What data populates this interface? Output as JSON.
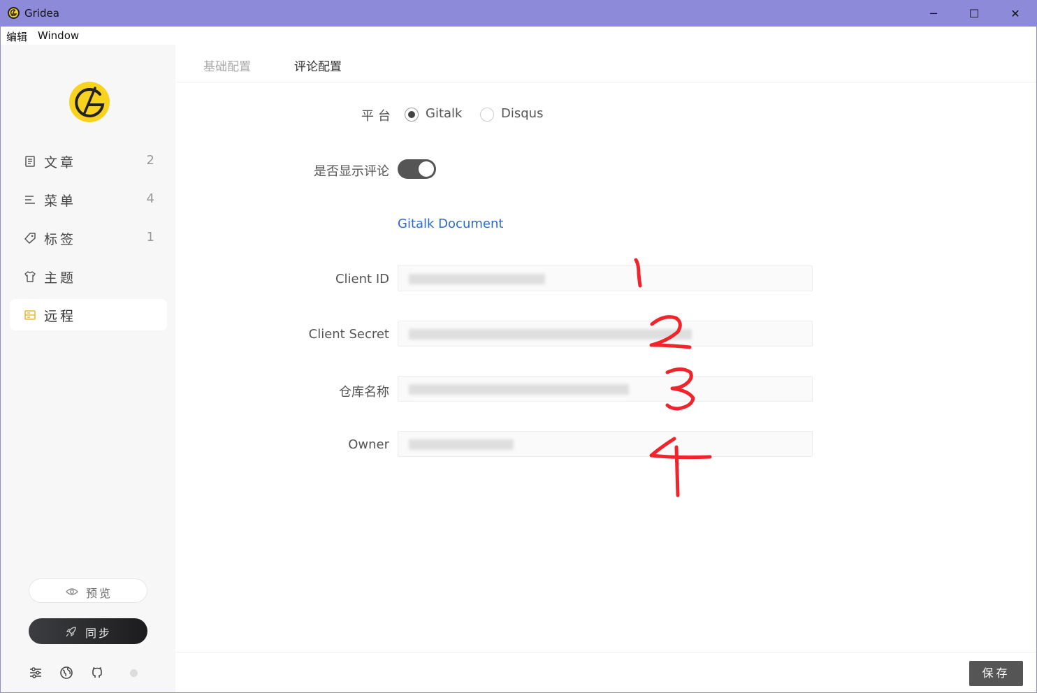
{
  "window": {
    "title": "Gridea",
    "controls": {
      "minimize": "─",
      "maximize": "☐",
      "close": "✕"
    }
  },
  "menubar": {
    "items": [
      "编辑",
      "Window"
    ]
  },
  "sidebar": {
    "items": [
      {
        "label": "文章",
        "count": "2",
        "icon": "article-icon"
      },
      {
        "label": "菜单",
        "count": "4",
        "icon": "menu-icon"
      },
      {
        "label": "标签",
        "count": "1",
        "icon": "tag-icon"
      },
      {
        "label": "主题",
        "count": "",
        "icon": "theme-shirt-icon"
      },
      {
        "label": "远程",
        "count": "",
        "icon": "remote-icon",
        "active": true
      }
    ],
    "preview_label": "预览",
    "sync_label": "同步",
    "footer_icons": [
      "settings-sliders-icon",
      "globe-icon",
      "github-icon"
    ]
  },
  "tabs": {
    "basic": "基础配置",
    "comment": "评论配置",
    "active": "comment"
  },
  "form": {
    "platform_label": "平台",
    "platform_options": [
      "Gitalk",
      "Disqus"
    ],
    "platform_selected": "Gitalk",
    "show_comment_label": "是否显示评论",
    "show_comment_on": true,
    "doc_link": "Gitalk Document",
    "client_id_label": "Client ID",
    "client_secret_label": "Client Secret",
    "repo_label": "仓库名称",
    "owner_label": "Owner"
  },
  "annotations": [
    "1",
    "2",
    "3",
    "4"
  ],
  "actions": {
    "save_label": "保存"
  },
  "colors": {
    "titlebar": "#8d8ad9",
    "accent_link": "#2c6bc9",
    "logo_yellow": "#f7d21e",
    "annotation_red": "#f0252b",
    "active_nav_icon": "#e9b824"
  }
}
